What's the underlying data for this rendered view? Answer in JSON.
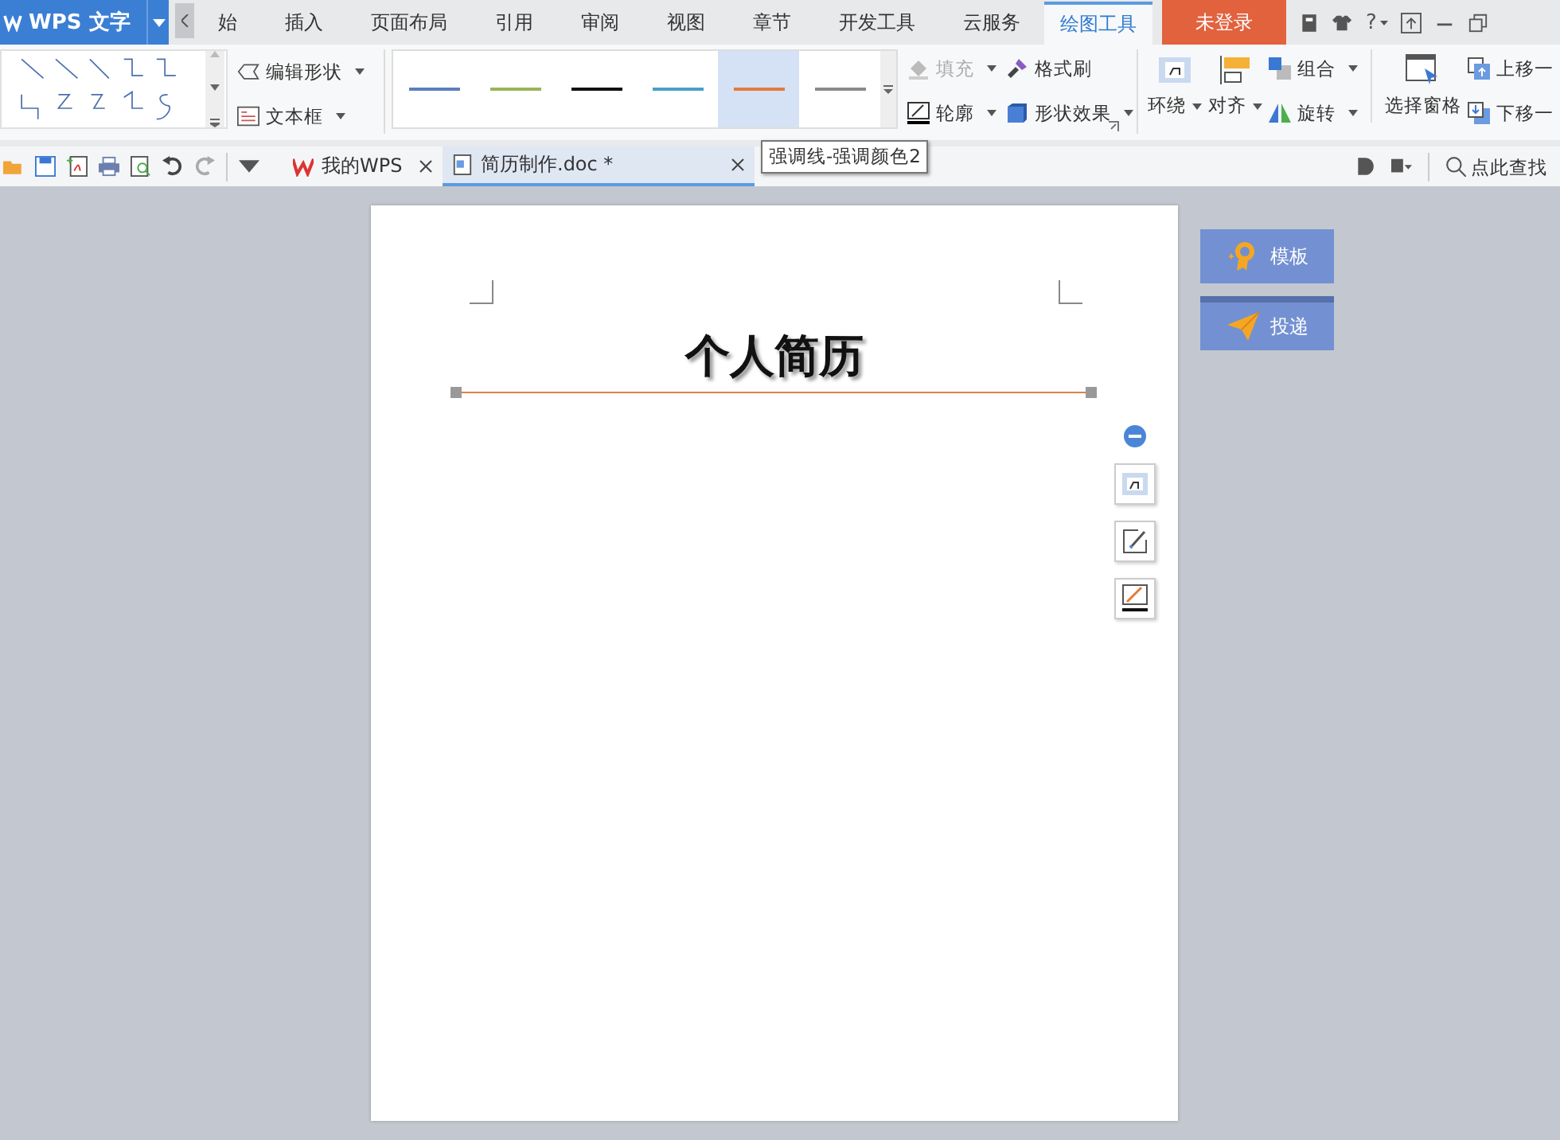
{
  "app_button": {
    "label": "WPS 文字"
  },
  "menu_tabs": [
    {
      "label": "始",
      "selected": false
    },
    {
      "label": "插入",
      "selected": false
    },
    {
      "label": "页面布局",
      "selected": false
    },
    {
      "label": "引用",
      "selected": false
    },
    {
      "label": "审阅",
      "selected": false
    },
    {
      "label": "视图",
      "selected": false
    },
    {
      "label": "章节",
      "selected": false
    },
    {
      "label": "开发工具",
      "selected": false
    },
    {
      "label": "云服务",
      "selected": false
    },
    {
      "label": "绘图工具",
      "selected": true
    }
  ],
  "login_button": {
    "label": "未登录"
  },
  "help_button": {
    "label": "?"
  },
  "ribbon": {
    "edit_shape": "编辑形状",
    "text_box": "文本框",
    "line_styles": [
      {
        "color": "#5b7fbf",
        "selected": false
      },
      {
        "color": "#98b45a",
        "selected": false
      },
      {
        "color": "#111111",
        "selected": false
      },
      {
        "color": "#4a9fc8",
        "selected": false
      },
      {
        "color": "#e47a3c",
        "selected": true
      },
      {
        "color": "#8a8a8a",
        "selected": false
      }
    ],
    "fill": {
      "label": "填充",
      "disabled": true
    },
    "format_painter": "格式刷",
    "outline": "轮廓",
    "shape_effects": "形状效果",
    "wrap": "环绕",
    "align": "对齐",
    "group": "组合",
    "rotate": "旋转",
    "selection_pane": "选择窗格",
    "move_up": "上移一",
    "move_down": "下移一"
  },
  "tooltip": "强调线-强调颜色2",
  "doc_tabs": [
    {
      "label": "我的WPS",
      "selected": false
    },
    {
      "label": "简历制作.doc *",
      "selected": true
    }
  ],
  "search": {
    "placeholder": "点此查找"
  },
  "document": {
    "title": "个人简历"
  },
  "side_buttons": [
    {
      "kind": "template",
      "label": "模板"
    },
    {
      "kind": "deliver",
      "label": "投递"
    }
  ]
}
